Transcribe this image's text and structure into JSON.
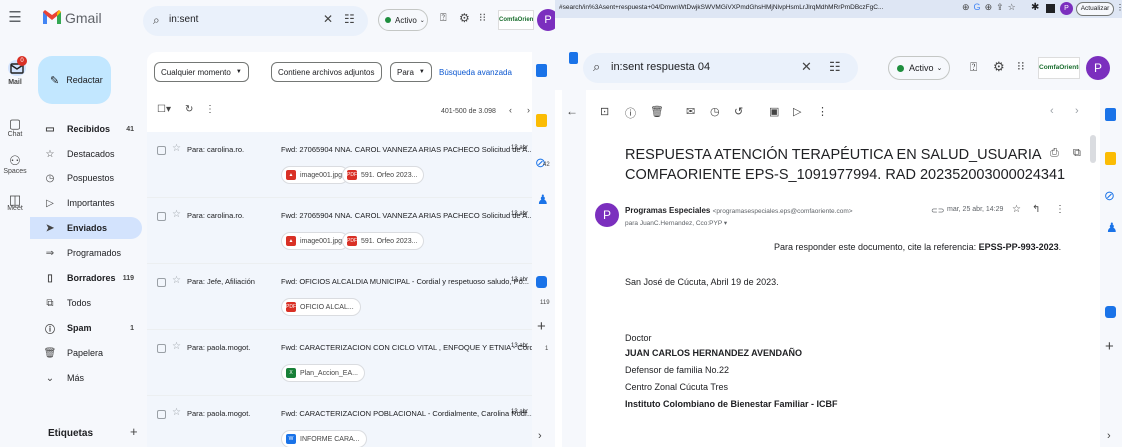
{
  "left": {
    "app_name": "Gmail",
    "search_value": "in:sent",
    "status_label": "Activo",
    "brand_logo_text": "ComfaOriente",
    "avatar_letter": "P",
    "rail": [
      {
        "icon": "mail-icon",
        "label": "Mail",
        "badge": "0"
      },
      {
        "icon": "chat-icon",
        "label": "Chat"
      },
      {
        "icon": "spaces-icon",
        "label": "Spaces"
      },
      {
        "icon": "meet-icon",
        "label": "Meet"
      }
    ],
    "compose_label": "Redactar",
    "nav": [
      {
        "icon": "inbox-icon",
        "label": "Recibidos",
        "count": "41",
        "bold": true
      },
      {
        "icon": "star-icon",
        "label": "Destacados",
        "count": ""
      },
      {
        "icon": "clock-icon",
        "label": "Pospuestos",
        "count": ""
      },
      {
        "icon": "important-icon",
        "label": "Importantes",
        "count": ""
      },
      {
        "icon": "send-icon",
        "label": "Enviados",
        "count": "",
        "bold": true,
        "active": true
      },
      {
        "icon": "scheduled-icon",
        "label": "Programados",
        "count": ""
      },
      {
        "icon": "draft-icon",
        "label": "Borradores",
        "count": "119",
        "bold": true
      },
      {
        "icon": "all-mail-icon",
        "label": "Todos",
        "count": ""
      },
      {
        "icon": "spam-icon",
        "label": "Spam",
        "count": "1",
        "bold": true
      },
      {
        "icon": "trash-icon",
        "label": "Papelera",
        "count": ""
      },
      {
        "icon": "chevron-down-icon",
        "label": "Más",
        "count": ""
      }
    ],
    "labels_heading": "Etiquetas",
    "filters": {
      "time": "Cualquier momento",
      "attachments": "Contiene archivos adjuntos",
      "to": "Para",
      "advanced": "Búsqueda avanzada"
    },
    "pagination": "401-500 de 3.098",
    "emails": [
      {
        "to": "Para: carolina.ro.",
        "subject": "Fwd: 27065904 NNA. CAROL VANNEZA ARIAS PACHECO Solicitud de A...",
        "date": "13 abr",
        "attachments": [
          {
            "name": "image001.jpg",
            "type": "img"
          },
          {
            "name": "591. Orfeo 2023...",
            "type": "pdf"
          }
        ]
      },
      {
        "to": "Para: carolina.ro.",
        "subject": "Fwd: 27065904 NNA. CAROL VANNEZA ARIAS PACHECO Solicitud de A...",
        "date": "13 abr",
        "attachments": [
          {
            "name": "image001.jpg",
            "type": "img"
          },
          {
            "name": "591. Orfeo 2023...",
            "type": "pdf"
          }
        ]
      },
      {
        "to": "Para: Jefe, Afiliación",
        "subject": "Fwd: OFICIOS ALCALDIA MUNICIPAL - Cordial y respetuoso saludo, Po...",
        "date": "13 abr",
        "attachments": [
          {
            "name": "OFICIO ALCAL...",
            "type": "pdf"
          }
        ]
      },
      {
        "to": "Para: paola.mogot.",
        "subject": "Fwd: CARACTERIZACION CON CICLO VITAL , ENFOQUE Y ETNIA - Cord...",
        "date": "13 abr",
        "attachments": [
          {
            "name": "Plan_Accion_EA...",
            "type": "xls"
          }
        ]
      },
      {
        "to": "Para: paola.mogot.",
        "subject": "Fwd: CARACTERIZACION POBLACIONAL - Cordialmente, Carolina Rodr...",
        "date": "13 abr",
        "attachments": [
          {
            "name": "INFORME CARA...",
            "type": "doc"
          }
        ]
      }
    ],
    "side_counts": [
      "42",
      "119",
      "1"
    ]
  },
  "right": {
    "url": "#search/in%3Asent+respuesta+04/DmwnWtDwjkSWVMGiVXPmdGhsHMjNlvpHsmLrJlrqMdhMRrPmDBczFgC...",
    "update_label": "Actualizar",
    "search_value": "in:sent respuesta 04",
    "status_label": "Activo",
    "brand_logo_text": "ComfaOriente",
    "avatar_letter": "P",
    "subject_line1": "RESPUESTA ATENCIÓN TERAPÉUTICA EN SALUD_USUARIA",
    "subject_line2": "COMFAORIENTE EPS-S_1091977994. RAD 202352003000024341",
    "sender_name": "Programas Especiales",
    "sender_email": "<programasespeciales.eps@comfaoriente.com>",
    "recipients": "para JuanC.Hernandez, Cco:PYP",
    "date": "mar, 25 abr, 14:29",
    "sender_avatar": "P",
    "reference_prefix": "Para responder este documento, cite la referencia: ",
    "reference_code": "EPSS-PP-993-2023",
    "reference_suffix": ".",
    "place_date": "San José de Cúcuta, Abril 19 de 2023.",
    "salutation": "Doctor",
    "addressee_name": "JUAN CARLOS HERNANDEZ AVENDAÑO",
    "addressee_title": "Defensor de familia No.22",
    "addressee_center": "Centro Zonal Cúcuta Tres",
    "addressee_org": "Instituto Colombiano de Bienestar Familiar - ICBF"
  },
  "colors": {
    "accent": "#0b57d0",
    "compose_bg": "#c2e7ff",
    "active_nav": "#d3e3fd",
    "status_green": "#1e8e3e",
    "avatar": "#7b2fbe"
  }
}
